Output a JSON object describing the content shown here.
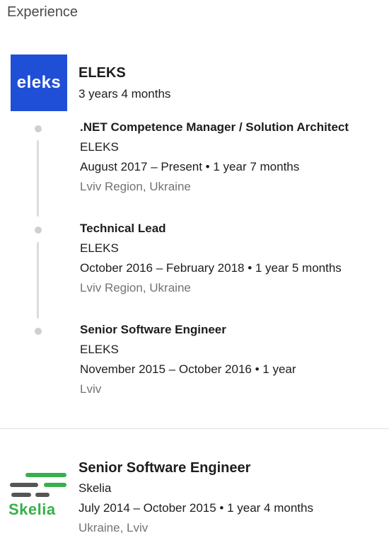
{
  "section": {
    "title": "Experience"
  },
  "eleks": {
    "logo_text": "eleks",
    "logo_color": "#1f4fd6",
    "name": "ELEKS",
    "duration": "3 years 4 months",
    "roles": [
      {
        "title": ".NET Competence Manager / Solution Architect",
        "company": "ELEKS",
        "dates": "August 2017 – Present • 1 year 7 months",
        "location": "Lviv Region, Ukraine"
      },
      {
        "title": "Technical Lead",
        "company": "ELEKS",
        "dates": "October 2016 – February 2018 • 1 year 5 months",
        "location": "Lviv Region, Ukraine"
      },
      {
        "title": "Senior Software Engineer",
        "company": "ELEKS",
        "dates": "November 2015 – October 2016 • 1 year",
        "location": "Lviv"
      }
    ]
  },
  "skelia": {
    "logo_text": "Skelia",
    "logo_color": "#36b04a",
    "title": "Senior Software Engineer",
    "company": "Skelia",
    "dates": "July 2014 – October 2015 • 1 year 4 months",
    "location": "Ukraine, Lviv"
  }
}
